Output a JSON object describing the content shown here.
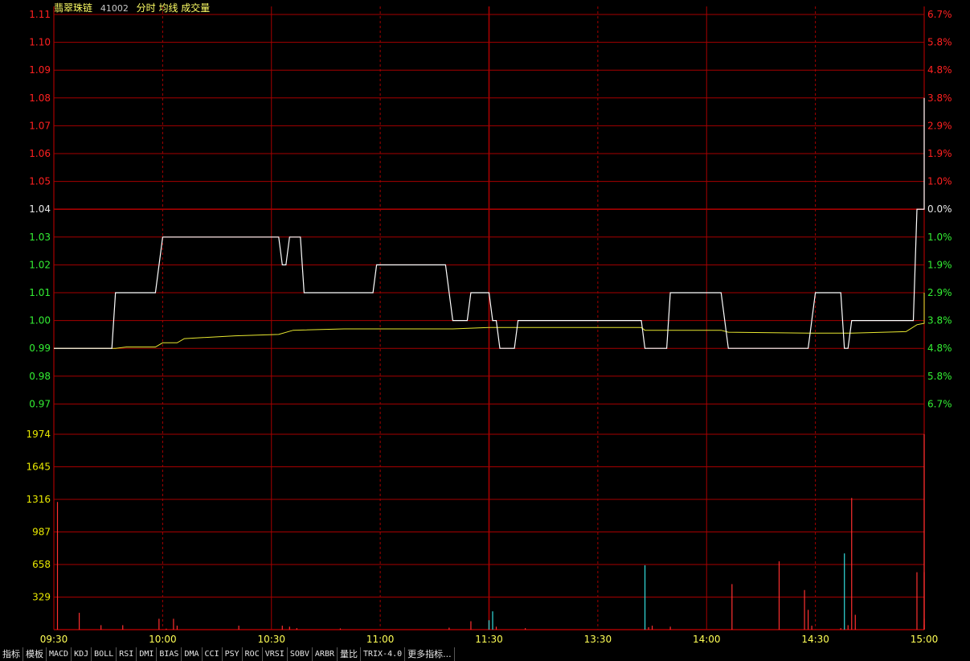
{
  "header": {
    "stock_name": "翡翠珠链",
    "code": "41002",
    "mode_label": "分时 均线 成交量"
  },
  "colors": {
    "grid": "#a60000",
    "price_line": "#ffffff",
    "avg_line": "#e8e830",
    "up": "#ff2020",
    "down": "#33ee33",
    "flat": "#e6e6e6",
    "volume_label": "#e8e800",
    "time_label": "#ffff55",
    "vol_up": "#ff3030",
    "vol_down": "#33dddd"
  },
  "tabs": [
    "指标",
    "模板",
    "MACD",
    "KDJ",
    "BOLL",
    "RSI",
    "DMI",
    "BIAS",
    "DMA",
    "CCI",
    "PSY",
    "ROC",
    "VRSI",
    "SOBV",
    "ARBR",
    "量比",
    "TRIX-4.0",
    "更多指标..."
  ],
  "chart_data": {
    "type": "line",
    "title": "",
    "prev_close": 1.04,
    "price_axis": {
      "left_labels": [
        "1.11",
        "1.10",
        "1.09",
        "1.08",
        "1.07",
        "1.06",
        "1.05",
        "1.04",
        "1.03",
        "1.02",
        "1.01",
        "1.00",
        "0.99",
        "0.98",
        "0.97"
      ],
      "right_labels": [
        "6.7%",
        "5.8%",
        "4.8%",
        "3.8%",
        "2.9%",
        "1.9%",
        "1.0%",
        "0.0%",
        "1.0%",
        "1.9%",
        "2.9%",
        "3.8%",
        "4.8%",
        "5.8%",
        "6.7%"
      ],
      "ylim": [
        0.97,
        1.11
      ]
    },
    "volume_axis": {
      "labels": [
        "1974",
        "1645",
        "1316",
        "987",
        "658",
        "329"
      ],
      "ylim": [
        0,
        1974
      ]
    },
    "time_labels": [
      "09:30",
      "10:00",
      "10:30",
      "11:00",
      "11:30",
      "13:30",
      "14:00",
      "14:30",
      "15:00"
    ],
    "series": [
      {
        "key": "price",
        "points": [
          [
            0,
            0.99
          ],
          [
            16,
            0.99
          ],
          [
            17,
            1.01
          ],
          [
            28,
            1.01
          ],
          [
            30,
            1.03
          ],
          [
            62,
            1.03
          ],
          [
            63,
            1.02
          ],
          [
            64,
            1.02
          ],
          [
            65,
            1.03
          ],
          [
            68,
            1.03
          ],
          [
            69,
            1.01
          ],
          [
            88,
            1.01
          ],
          [
            89,
            1.02
          ],
          [
            108,
            1.02
          ],
          [
            110,
            1.0
          ],
          [
            114,
            1.0
          ],
          [
            115,
            1.01
          ],
          [
            120,
            1.01
          ],
          [
            121,
            1.0
          ],
          [
            122,
            1.0
          ],
          [
            123,
            0.99
          ],
          [
            127,
            0.99
          ],
          [
            128,
            1.0
          ],
          [
            162,
            1.0
          ],
          [
            163,
            0.99
          ],
          [
            169,
            0.99
          ],
          [
            170,
            1.01
          ],
          [
            184,
            1.01
          ],
          [
            186,
            0.99
          ],
          [
            208,
            0.99
          ],
          [
            210,
            1.01
          ],
          [
            217,
            1.01
          ],
          [
            218,
            0.99
          ],
          [
            219,
            0.99
          ],
          [
            220,
            1.0
          ],
          [
            237,
            1.0
          ],
          [
            238,
            1.04
          ],
          [
            241,
            1.04
          ],
          [
            242,
            1.05
          ],
          [
            245,
            1.05
          ],
          [
            246,
            1.08
          ]
        ]
      },
      {
        "key": "avg",
        "points": [
          [
            0,
            0.99
          ],
          [
            17,
            0.99
          ],
          [
            20,
            0.9905
          ],
          [
            28,
            0.9905
          ],
          [
            30,
            0.992
          ],
          [
            34,
            0.992
          ],
          [
            36,
            0.9935
          ],
          [
            50,
            0.9945
          ],
          [
            62,
            0.995
          ],
          [
            66,
            0.9965
          ],
          [
            80,
            0.997
          ],
          [
            110,
            0.997
          ],
          [
            120,
            0.9975
          ],
          [
            130,
            0.9975
          ],
          [
            162,
            0.9975
          ],
          [
            163,
            0.9965
          ],
          [
            184,
            0.9965
          ],
          [
            186,
            0.9958
          ],
          [
            208,
            0.9955
          ],
          [
            220,
            0.9955
          ],
          [
            235,
            0.996
          ],
          [
            238,
            0.9985
          ],
          [
            244,
            0.999
          ],
          [
            245,
            1.0
          ],
          [
            246,
            1.01
          ]
        ]
      }
    ],
    "volume": [
      {
        "t": 1,
        "v": 1290,
        "dir": "up"
      },
      {
        "t": 7,
        "v": 170,
        "dir": "up"
      },
      {
        "t": 13,
        "v": 45,
        "dir": "up"
      },
      {
        "t": 19,
        "v": 45,
        "dir": "up"
      },
      {
        "t": 29,
        "v": 110,
        "dir": "up"
      },
      {
        "t": 31,
        "v": 10,
        "dir": "up"
      },
      {
        "t": 33,
        "v": 110,
        "dir": "up"
      },
      {
        "t": 34,
        "v": 40,
        "dir": "up"
      },
      {
        "t": 51,
        "v": 40,
        "dir": "up"
      },
      {
        "t": 63,
        "v": 40,
        "dir": "up"
      },
      {
        "t": 65,
        "v": 30,
        "dir": "up"
      },
      {
        "t": 67,
        "v": 15,
        "dir": "up"
      },
      {
        "t": 79,
        "v": 12,
        "dir": "up"
      },
      {
        "t": 109,
        "v": 20,
        "dir": "up"
      },
      {
        "t": 115,
        "v": 85,
        "dir": "up"
      },
      {
        "t": 120,
        "v": 95,
        "dir": "down"
      },
      {
        "t": 121,
        "v": 185,
        "dir": "down"
      },
      {
        "t": 122,
        "v": 30,
        "dir": "up"
      },
      {
        "t": 130,
        "v": 15,
        "dir": "up"
      },
      {
        "t": 163,
        "v": 650,
        "dir": "down"
      },
      {
        "t": 164,
        "v": 25,
        "dir": "up"
      },
      {
        "t": 165,
        "v": 40,
        "dir": "up"
      },
      {
        "t": 170,
        "v": 30,
        "dir": "up"
      },
      {
        "t": 187,
        "v": 460,
        "dir": "up"
      },
      {
        "t": 200,
        "v": 690,
        "dir": "up"
      },
      {
        "t": 207,
        "v": 400,
        "dir": "up"
      },
      {
        "t": 208,
        "v": 200,
        "dir": "up"
      },
      {
        "t": 209,
        "v": 40,
        "dir": "up"
      },
      {
        "t": 217,
        "v": 15,
        "dir": "up"
      },
      {
        "t": 218,
        "v": 770,
        "dir": "down"
      },
      {
        "t": 219,
        "v": 45,
        "dir": "up"
      },
      {
        "t": 220,
        "v": 1330,
        "dir": "up"
      },
      {
        "t": 221,
        "v": 150,
        "dir": "up"
      },
      {
        "t": 238,
        "v": 580,
        "dir": "up"
      },
      {
        "t": 242,
        "v": 110,
        "dir": "up"
      },
      {
        "t": 243,
        "v": 50,
        "dir": "up"
      },
      {
        "t": 245,
        "v": 580,
        "dir": "up"
      },
      {
        "t": 246,
        "v": 1974,
        "dir": "up"
      }
    ]
  }
}
